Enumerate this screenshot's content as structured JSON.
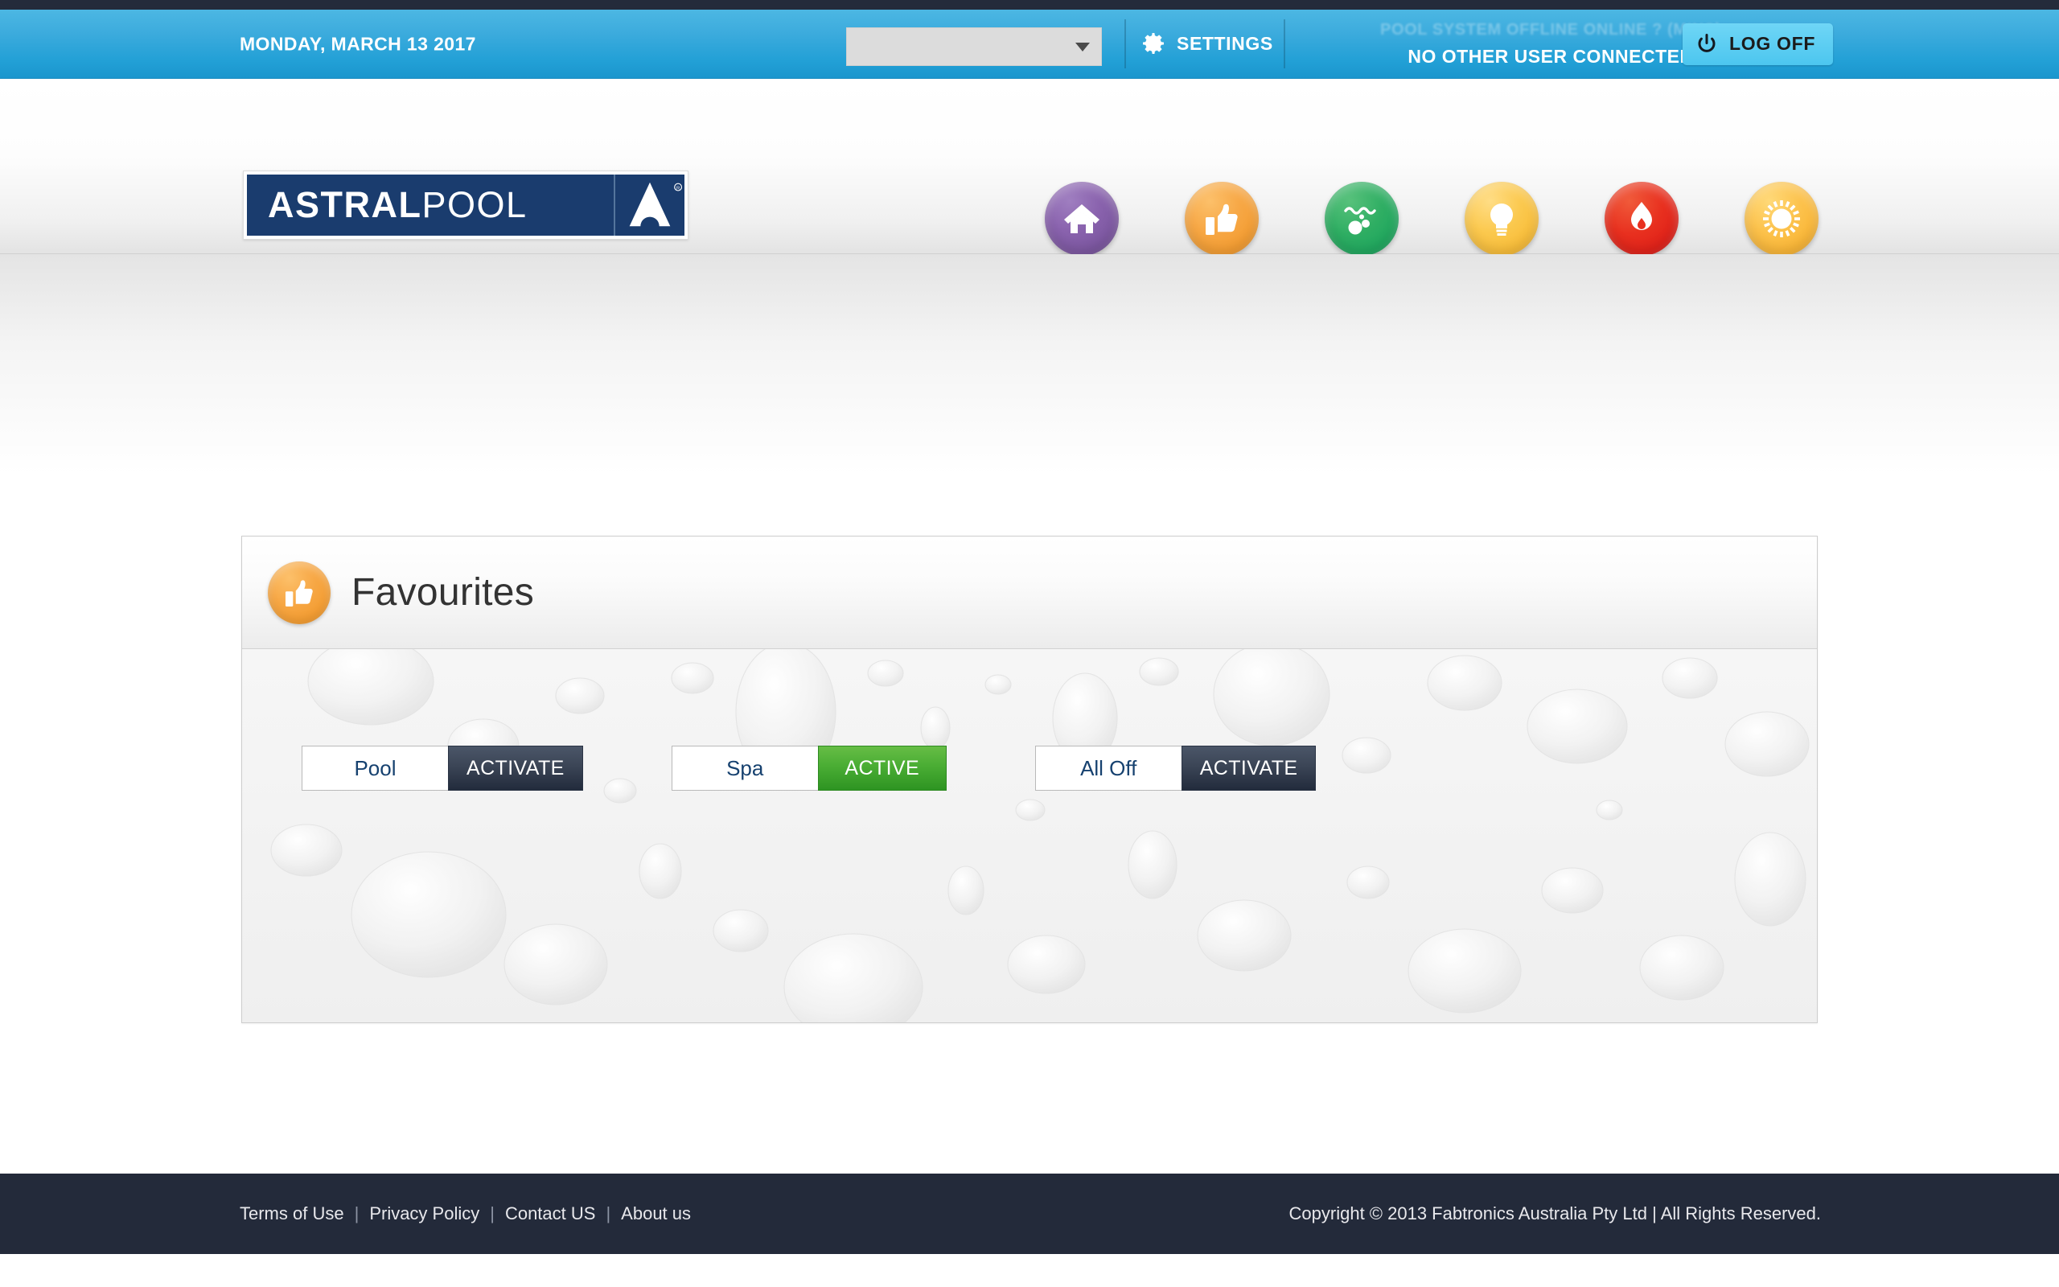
{
  "topbar": {
    "date": "MONDAY, MARCH 13 2017",
    "user_select": {
      "value": "",
      "placeholder": "",
      "caret_icon": "chevron-down-icon"
    },
    "settings_label": "SETTINGS",
    "settings_icon": "gear-icon",
    "status_faded": "POOL SYSTEM OFFLINE  ONLINE  ?  (MINS)",
    "status_main": "NO OTHER USER CONNECTED",
    "logoff_label": "LOG OFF",
    "logoff_icon": "power-icon",
    "accent_color": "#22a0d6",
    "logoff_color": "#4cc6ef"
  },
  "brand": {
    "logo_primary": "ASTRAL",
    "logo_secondary": "POOL",
    "logo_mark": "astral-triangle-mark",
    "logo_color": "#1a3c6e"
  },
  "nav": {
    "items": [
      {
        "label": "Home",
        "icon": "home-icon",
        "color": "#8a63ae"
      },
      {
        "label": "Favourites",
        "icon": "thumbs-up-icon",
        "color": "#f7a846"
      },
      {
        "label": "Pool & Spa",
        "icon": "bubbles-icon",
        "color": "#2fae63"
      },
      {
        "label": "Lighting",
        "icon": "lightbulb-icon",
        "color": "#fbc94f"
      },
      {
        "label": "Heating",
        "icon": "flame-icon",
        "color": "#e8301f"
      },
      {
        "label": "Solar",
        "icon": "sun-icon",
        "color": "#fcc24c"
      }
    ]
  },
  "panel": {
    "title": "Favourites",
    "icon": "thumbs-up-icon",
    "favourites": [
      {
        "name": "Pool",
        "action_label": "ACTIVATE",
        "state": "inactive"
      },
      {
        "name": "Spa",
        "action_label": "ACTIVE",
        "state": "active"
      },
      {
        "name": "All Off",
        "action_label": "ACTIVATE",
        "state": "inactive"
      }
    ]
  },
  "footer": {
    "links": [
      "Terms of Use",
      "Privacy Policy",
      "Contact US",
      "About us"
    ],
    "separator": "|",
    "copyright": "Copyright © 2013 Fabtronics Australia Pty Ltd  |  All Rights Reserved."
  }
}
